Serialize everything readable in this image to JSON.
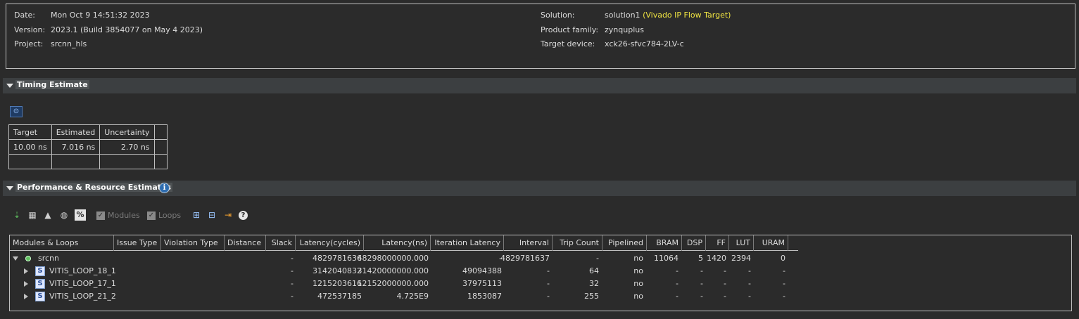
{
  "summary": {
    "date_label": "Date:",
    "date_value": "Mon Oct 9 14:51:32 2023",
    "version_label": "Version:",
    "version_value": "2023.1 (Build 3854077 on May 4 2023)",
    "project_label": "Project:",
    "project_value": "srcnn_hls",
    "solution_label": "Solution:",
    "solution_value": "solution1",
    "solution_flow": "(Vivado IP Flow Target)",
    "family_label": "Product family:",
    "family_value": "zynquplus",
    "device_label": "Target device:",
    "device_value": "xck26-sfvc784-2LV-c"
  },
  "timing": {
    "section_title": "Timing Estimate",
    "icon": "clock-icon",
    "headers": [
      "Target",
      "Estimated",
      "Uncertainty"
    ],
    "row": [
      "10.00 ns",
      "7.016 ns",
      "2.70 ns"
    ]
  },
  "perf": {
    "section_title": "Performance & Resource Estimates",
    "info_icon": "info-icon",
    "toolbar": {
      "modules_label": "Modules",
      "loops_label": "Loops"
    },
    "headers": [
      "Modules & Loops",
      "Issue Type",
      "Violation Type",
      "Distance",
      "Slack",
      "Latency(cycles)",
      "Latency(ns)",
      "Iteration Latency",
      "Interval",
      "Trip Count",
      "Pipelined",
      "BRAM",
      "DSP",
      "FF",
      "LUT",
      "URAM"
    ],
    "rows": [
      {
        "name": "srcnn",
        "issue": "",
        "violation": "",
        "distance": "",
        "slack": "-",
        "lat_cycles": "4829781636",
        "lat_ns": "48298000000.000",
        "iter_lat": "-",
        "interval": "4829781637",
        "trip": "-",
        "pipelined": "no",
        "bram": "11064",
        "dsp": "5",
        "ff": "1420",
        "lut": "2394",
        "uram": "0"
      },
      {
        "name": "VITIS_LOOP_18_1",
        "issue": "",
        "violation": "",
        "distance": "",
        "slack": "-",
        "lat_cycles": "3142040832",
        "lat_ns": "31420000000.000",
        "iter_lat": "49094388",
        "interval": "-",
        "trip": "64",
        "pipelined": "no",
        "bram": "-",
        "dsp": "-",
        "ff": "-",
        "lut": "-",
        "uram": "-"
      },
      {
        "name": "VITIS_LOOP_17_1",
        "issue": "",
        "violation": "",
        "distance": "",
        "slack": "-",
        "lat_cycles": "1215203616",
        "lat_ns": "12152000000.000",
        "iter_lat": "37975113",
        "interval": "-",
        "trip": "32",
        "pipelined": "no",
        "bram": "-",
        "dsp": "-",
        "ff": "-",
        "lut": "-",
        "uram": "-"
      },
      {
        "name": "VITIS_LOOP_21_2",
        "issue": "",
        "violation": "",
        "distance": "",
        "slack": "-",
        "lat_cycles": "472537185",
        "lat_ns": "4.725E9",
        "iter_lat": "1853087",
        "interval": "-",
        "trip": "255",
        "pipelined": "no",
        "bram": "-",
        "dsp": "-",
        "ff": "-",
        "lut": "-",
        "uram": "-"
      }
    ]
  }
}
